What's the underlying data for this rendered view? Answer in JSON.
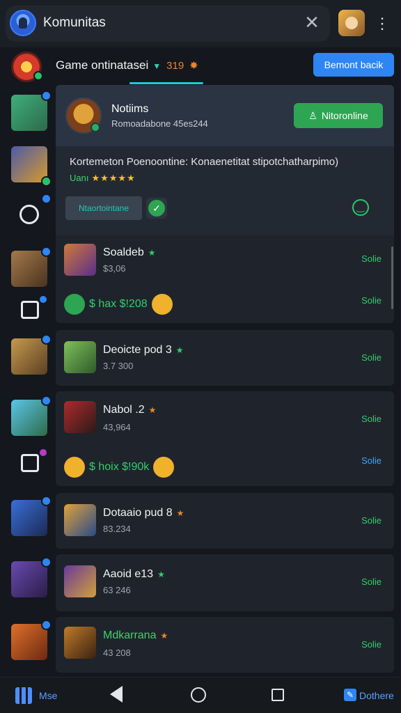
{
  "topbar": {
    "title": "Komunitas",
    "close_glyph": "✕",
    "menu_glyph": "⋮"
  },
  "game": {
    "title": "Game ontinatasei",
    "count": "319",
    "primary_button": "Bemont bacik"
  },
  "notice": {
    "title": "Notiims",
    "subtitle": "Romoadabone 45es244",
    "button": "Nitoronline",
    "description": "Kortemeton Poenoontine: Konaenetitat stipotchatharpimo)",
    "rating_label": "Uanı",
    "stars": "★★★★★",
    "chip": "Ntaortointane"
  },
  "list": [
    {
      "name": "Soaldeb",
      "sub": "$3,06",
      "action": "Solie",
      "star_color": "#2fcf6a",
      "row2": {
        "text": "$ hax $!208",
        "action": "Solie"
      }
    },
    {
      "name": "Deoicte pod 3",
      "sub": "3.7 300",
      "action": "Solie",
      "star_color": "#2fcf6a"
    },
    {
      "name": "Nabol .2",
      "sub": "43,964",
      "action": "Solie",
      "star_color": "#e8862c",
      "row2": {
        "text": "$ hoix $!90k",
        "action": "Solie"
      }
    },
    {
      "name": "Dotaaio pud 8",
      "sub": "83.234",
      "action": "Solie",
      "star_color": "#e8862c"
    },
    {
      "name": "Aaoid e13",
      "sub": "63 246",
      "action": "Solie",
      "star_color": "#2fcf6a"
    },
    {
      "name": "Mdkarrana",
      "sub": "43 208",
      "action": "Solie",
      "star_color": "#e8862c"
    }
  ],
  "bottomnav": {
    "left_label": "Mse",
    "right_label": "Dothere"
  },
  "colors": {
    "accent_blue": "#2d86f4",
    "accent_green": "#2ea552",
    "background": "#14171d"
  }
}
